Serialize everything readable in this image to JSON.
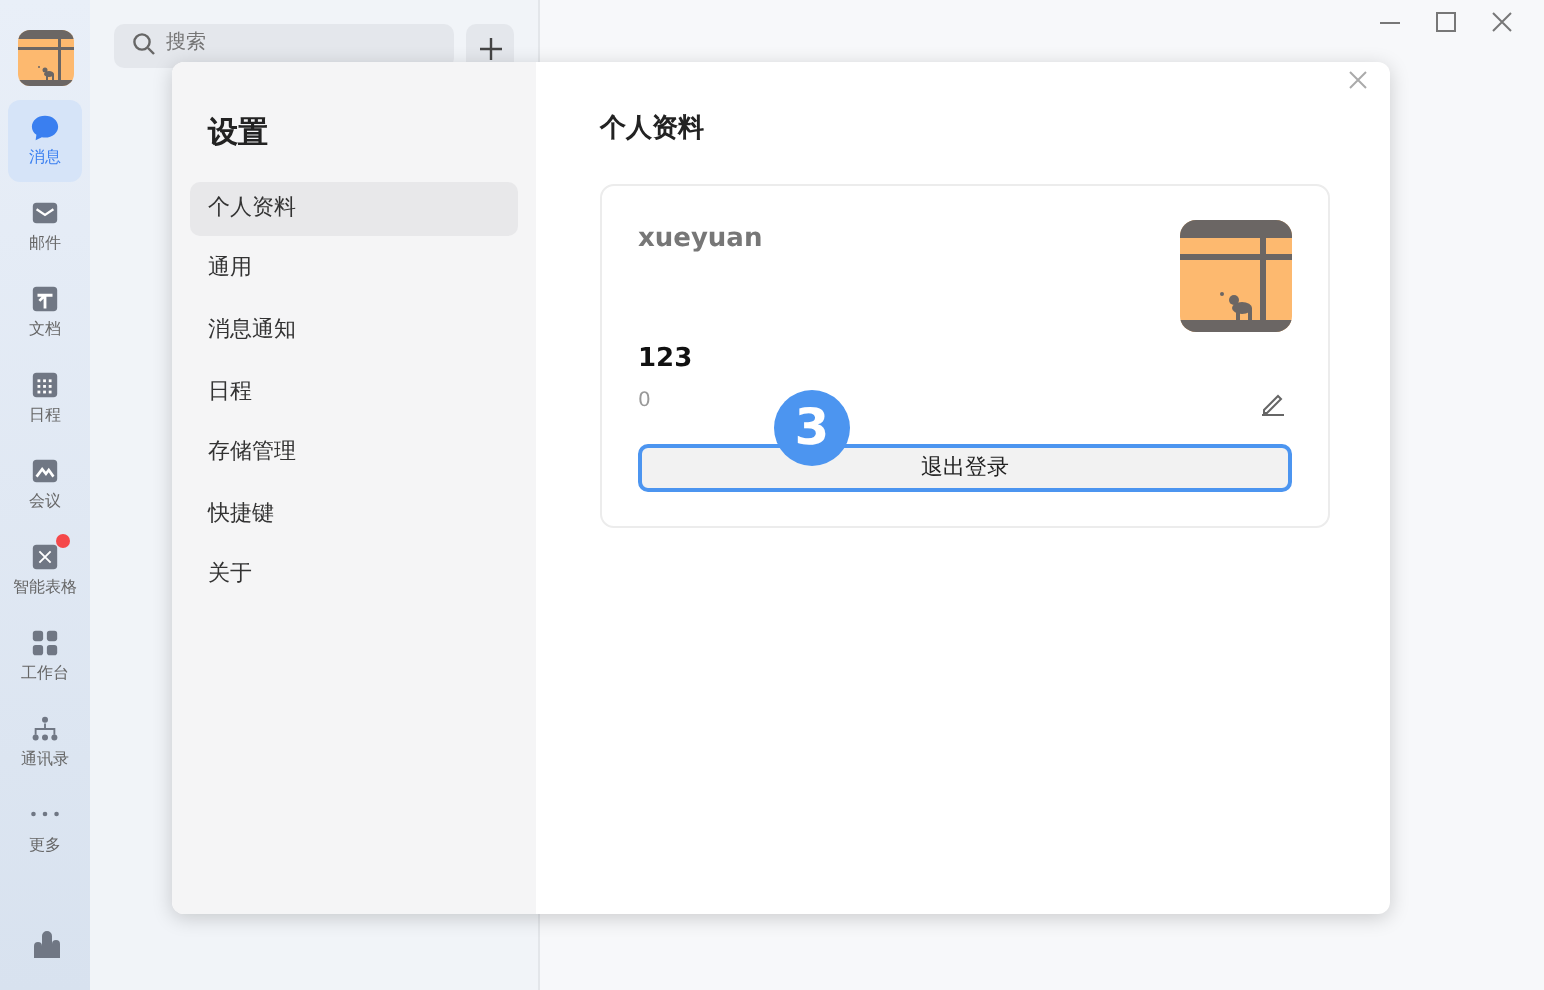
{
  "rail": {
    "items": [
      {
        "label": "消息",
        "selected": true,
        "badge": false
      },
      {
        "label": "邮件",
        "selected": false,
        "badge": false
      },
      {
        "label": "文档",
        "selected": false,
        "badge": false
      },
      {
        "label": "日程",
        "selected": false,
        "badge": false
      },
      {
        "label": "会议",
        "selected": false,
        "badge": false
      },
      {
        "label": "智能表格",
        "selected": false,
        "badge": true
      },
      {
        "label": "工作台",
        "selected": false,
        "badge": false
      },
      {
        "label": "通讯录",
        "selected": false,
        "badge": false
      },
      {
        "label": "更多",
        "selected": false,
        "badge": false
      }
    ]
  },
  "search": {
    "placeholder": "搜索"
  },
  "settings": {
    "title": "设置",
    "menu": [
      {
        "label": "个人资料",
        "selected": true
      },
      {
        "label": "通用",
        "selected": false
      },
      {
        "label": "消息通知",
        "selected": false
      },
      {
        "label": "日程",
        "selected": false
      },
      {
        "label": "存储管理",
        "selected": false
      },
      {
        "label": "快捷键",
        "selected": false
      },
      {
        "label": "关于",
        "selected": false
      }
    ],
    "section_title": "个人资料",
    "profile": {
      "name": "xueyuan",
      "number": "123",
      "count": "0",
      "logout_button": "退出登录"
    }
  },
  "step_marker": "3"
}
